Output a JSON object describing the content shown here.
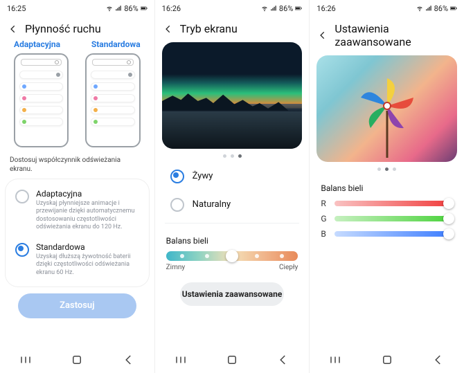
{
  "status": {
    "time1": "16:25",
    "time2": "16:26",
    "time3": "16:26",
    "battery": "86%"
  },
  "screen1": {
    "title": "Płynność ruchu",
    "tabA": "Adaptacyjna",
    "tabB": "Standardowa",
    "caption": "Dostosuj współczynnik odświeżania ekranu.",
    "optA": {
      "title": "Adaptacyjna",
      "desc": "Uzyskaj płynniejsze animacje i przewijanie dzięki automatycznemu dostosowaniu częstotliwości odświeżania ekranu do 120 Hz."
    },
    "optB": {
      "title": "Standardowa",
      "desc": "Uzyskaj dłuższą żywotność baterii dzięki częstotliwości odświeżania ekranu 60 Hz."
    },
    "apply": "Zastosuj",
    "miniDots": [
      "#9aa0a6",
      "#6fa8ff",
      "#ef7aa6",
      "#f3b04a",
      "#7ed46a"
    ]
  },
  "screen2": {
    "title": "Tryb ekranu",
    "radioA": "Żywy",
    "radioB": "Naturalny",
    "wbTitle": "Balans bieli",
    "wbCold": "Zimny",
    "wbWarm": "Ciepły",
    "advanced": "Ustawienia zaawansowane",
    "pager": 3,
    "pagerActive": 2
  },
  "screen3": {
    "title": "Ustawienia zaawansowane",
    "wbTitle": "Balans bieli",
    "labels": {
      "r": "R",
      "g": "G",
      "b": "B"
    },
    "pager": 3,
    "pagerActive": 1
  }
}
